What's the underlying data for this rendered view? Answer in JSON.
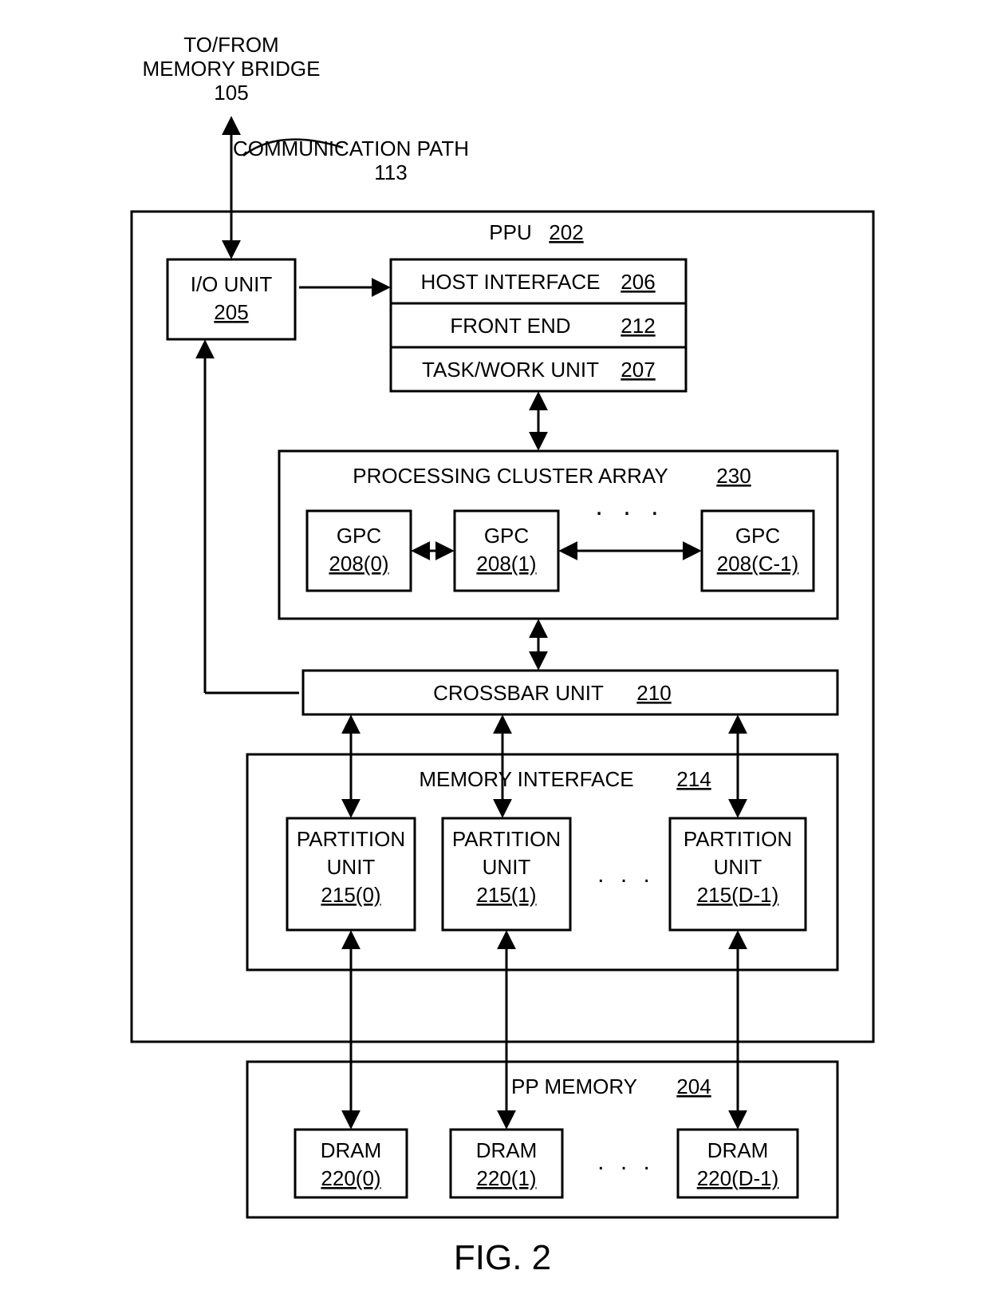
{
  "top": {
    "line1": "TO/FROM",
    "line2": "MEMORY BRIDGE",
    "line3": "105",
    "comm_path_line1": "COMMUNICATION PATH",
    "comm_path_line2": "113"
  },
  "ppu": {
    "name": "PPU",
    "id": "202"
  },
  "io_unit": {
    "name": "I/O UNIT",
    "id": "205"
  },
  "host_interface": {
    "name": "HOST INTERFACE",
    "id": "206"
  },
  "front_end": {
    "name": "FRONT END",
    "id": "212"
  },
  "task_work_unit": {
    "name": "TASK/WORK UNIT",
    "id": "207"
  },
  "pca": {
    "name": "PROCESSING CLUSTER ARRAY",
    "id": "230"
  },
  "gpc0": {
    "name": "GPC",
    "id": "208(0)"
  },
  "gpc1": {
    "name": "GPC",
    "id": "208(1)"
  },
  "gpcC": {
    "name": "GPC",
    "id": "208(C-1)"
  },
  "dots": ". . .",
  "dots_small": ". . .",
  "crossbar": {
    "name": "CROSSBAR UNIT",
    "id": "210"
  },
  "mem_if": {
    "name": "MEMORY INTERFACE",
    "id": "214"
  },
  "pu0": {
    "name": "PARTITION",
    "name2": "UNIT",
    "id": "215(0)"
  },
  "pu1": {
    "name": "PARTITION",
    "name2": "UNIT",
    "id": "215(1)"
  },
  "puD": {
    "name": "PARTITION",
    "name2": "UNIT",
    "id": "215(D-1)"
  },
  "pp_mem": {
    "name": "PP MEMORY",
    "id": "204"
  },
  "dram0": {
    "name": "DRAM",
    "id": "220(0)"
  },
  "dram1": {
    "name": "DRAM",
    "id": "220(1)"
  },
  "dramD": {
    "name": "DRAM",
    "id": "220(D-1)"
  },
  "figure": "FIG. 2"
}
